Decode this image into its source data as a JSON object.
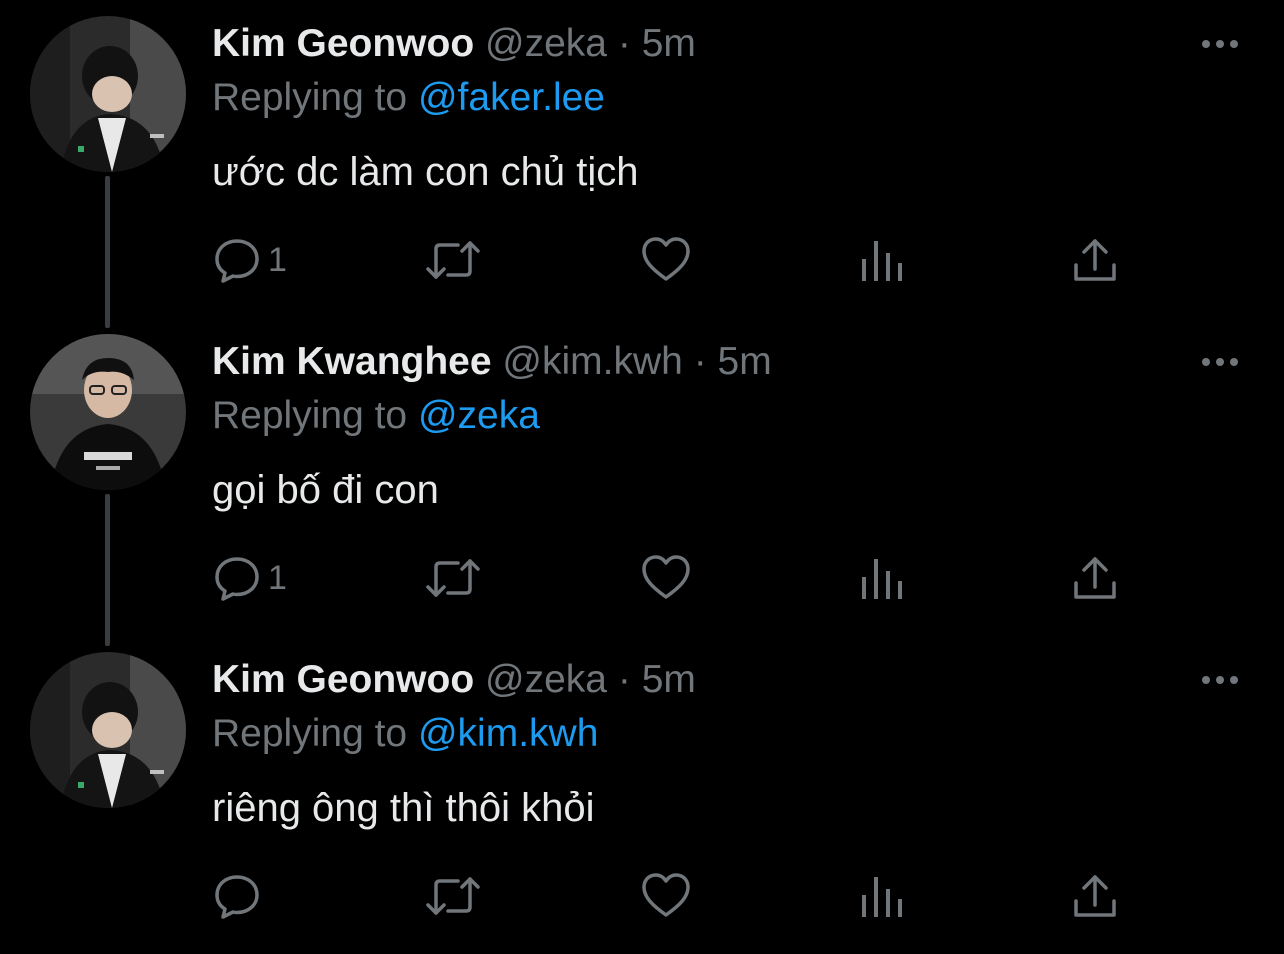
{
  "tweets": [
    {
      "name": "Kim Geonwoo",
      "handle": "@zeka",
      "separator": "·",
      "time": "5m",
      "replying_prefix": "Replying to",
      "replying_to": "@faker.lee",
      "text": "ước dc làm con chủ tịch",
      "reply_count": "1",
      "avatar_icon": "avatar-photo-kim-geonwoo"
    },
    {
      "name": "Kim Kwanghee",
      "handle": "@kim.kwh",
      "separator": "·",
      "time": "5m",
      "replying_prefix": "Replying to",
      "replying_to": "@zeka",
      "text": "gọi bố đi con",
      "reply_count": "1",
      "avatar_icon": "avatar-photo-kim-kwanghee"
    },
    {
      "name": "Kim Geonwoo",
      "handle": "@zeka",
      "separator": "·",
      "time": "5m",
      "replying_prefix": "Replying to",
      "replying_to": "@kim.kwh",
      "text": "riêng ông thì thôi khỏi",
      "reply_count": "",
      "avatar_icon": "avatar-photo-kim-geonwoo"
    }
  ],
  "icons": [
    "reply-icon",
    "retweet-icon",
    "like-icon",
    "views-icon",
    "share-icon",
    "more-icon"
  ],
  "colors": {
    "background": "#000000",
    "primary_text": "#e7e9ea",
    "secondary_text": "#71767b",
    "accent": "#1d9bf0",
    "thread_line": "#3a3d40"
  }
}
